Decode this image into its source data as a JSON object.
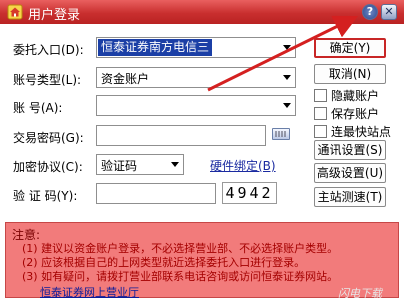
{
  "window": {
    "title": "用户登录",
    "help_glyph": "?",
    "close_glyph": "✕"
  },
  "form": {
    "delegate_entry": {
      "label": "委托入口(D):",
      "value": "恒泰证券南方电信三"
    },
    "account_type": {
      "label": "账号类型(L):",
      "value": "资金账户"
    },
    "account": {
      "label": "账      号(A):",
      "value": ""
    },
    "trade_password": {
      "label": "交易密码(G):",
      "value": ""
    },
    "encryption": {
      "label": "加密协议(C):",
      "value": "验证码"
    },
    "hardware_bind_link": "硬件绑定(B)",
    "captcha": {
      "label": "验 证 码(Y):",
      "value": "",
      "code": "4942"
    }
  },
  "buttons": {
    "confirm": "确定(Y)",
    "cancel": "取消(N)",
    "comm_settings": "通讯设置(S)",
    "advanced_settings": "高级设置(U)",
    "main_station_test": "主站测速(T)"
  },
  "checkboxes": {
    "hide_account": "隐藏账户",
    "save_account": "保存账户",
    "fastest_site": "连最快站点"
  },
  "notice": {
    "title": "注意:",
    "lines": [
      "(1) 建议以资金账户登录，不必选择营业部、不必选择账户类型。",
      "(2) 应该根据自己的上网类型就近选择委托入口进行登录。",
      "(3) 如有疑问，请拨打营业部联系电话咨询或访问恒泰证券网站。"
    ],
    "link": "恒泰证券网上营业厅"
  },
  "watermark": "闪电下载",
  "colors": {
    "title_bar": "#c92f2f",
    "primary_border": "#c82626",
    "notice_bg": "#f27b7b",
    "notice_text": "#a40000",
    "selection": "#1b3fa6",
    "annotation_arrow": "#d42020"
  },
  "icons": {
    "app": "app-house-icon",
    "help": "help-icon",
    "close": "close-icon",
    "keyboard": "soft-keyboard-icon"
  }
}
